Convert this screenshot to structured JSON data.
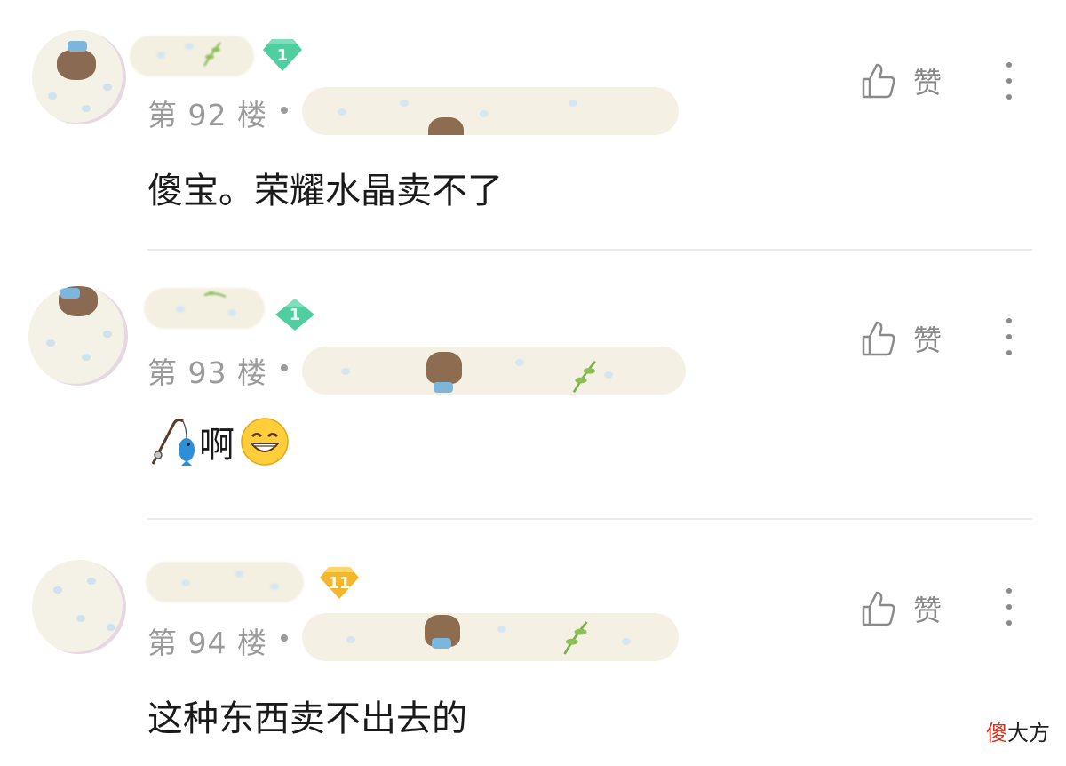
{
  "comments": [
    {
      "floor": "第 92 楼",
      "text": "傻宝。荣耀水晶卖不了",
      "level": "1",
      "like_label": "赞"
    },
    {
      "floor": "第 93 楼",
      "text": "啊",
      "level": "1",
      "like_label": "赞"
    },
    {
      "floor": "第 94 楼",
      "text": "这种东西卖不出去的",
      "level": "11",
      "like_label": "赞"
    }
  ],
  "colors": {
    "level_green": "#4fcf9f",
    "level_gold": "#f5b72a",
    "floor_gray": "#9a9a9a",
    "watermark_red": "#d9301e"
  },
  "icons": [
    "thumbs-up-icon",
    "more-vertical-icon",
    "fishing-rod-emoji",
    "grinning-emoji",
    "level-badge-icon"
  ],
  "watermark": {
    "first": "傻",
    "rest": "大方"
  }
}
